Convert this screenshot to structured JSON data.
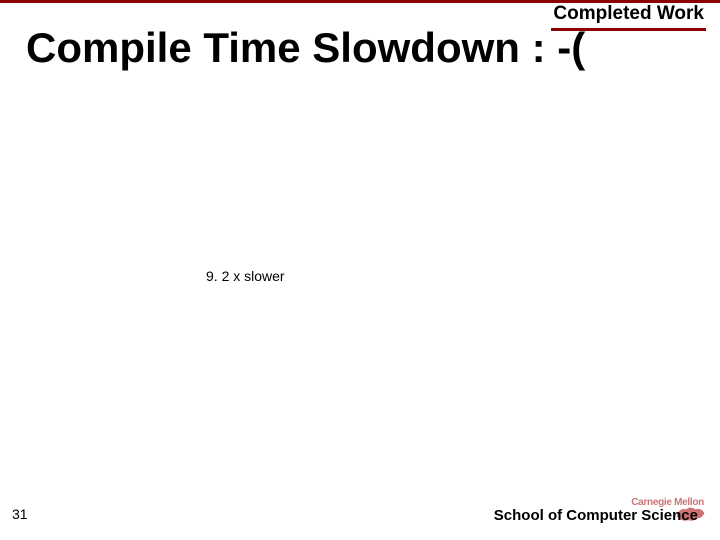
{
  "header": {
    "section": "Completed Work"
  },
  "title": "Compile Time Slowdown : -(",
  "note": "9. 2 x slower",
  "footer": {
    "page": "31",
    "school": "School of Computer Science",
    "university": "Carnegie Mellon"
  }
}
